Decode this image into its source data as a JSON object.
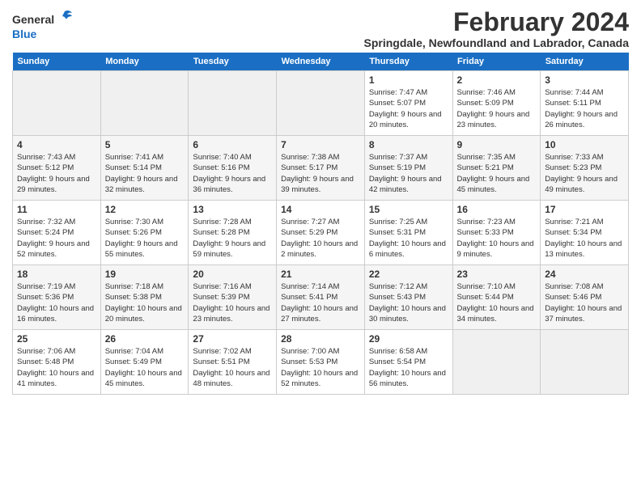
{
  "logo": {
    "general": "General",
    "blue": "Blue"
  },
  "title": "February 2024",
  "subtitle": "Springdale, Newfoundland and Labrador, Canada",
  "headers": [
    "Sunday",
    "Monday",
    "Tuesday",
    "Wednesday",
    "Thursday",
    "Friday",
    "Saturday"
  ],
  "weeks": [
    [
      {
        "day": "",
        "info": ""
      },
      {
        "day": "",
        "info": ""
      },
      {
        "day": "",
        "info": ""
      },
      {
        "day": "",
        "info": ""
      },
      {
        "day": "1",
        "info": "Sunrise: 7:47 AM\nSunset: 5:07 PM\nDaylight: 9 hours and 20 minutes."
      },
      {
        "day": "2",
        "info": "Sunrise: 7:46 AM\nSunset: 5:09 PM\nDaylight: 9 hours and 23 minutes."
      },
      {
        "day": "3",
        "info": "Sunrise: 7:44 AM\nSunset: 5:11 PM\nDaylight: 9 hours and 26 minutes."
      }
    ],
    [
      {
        "day": "4",
        "info": "Sunrise: 7:43 AM\nSunset: 5:12 PM\nDaylight: 9 hours and 29 minutes."
      },
      {
        "day": "5",
        "info": "Sunrise: 7:41 AM\nSunset: 5:14 PM\nDaylight: 9 hours and 32 minutes."
      },
      {
        "day": "6",
        "info": "Sunrise: 7:40 AM\nSunset: 5:16 PM\nDaylight: 9 hours and 36 minutes."
      },
      {
        "day": "7",
        "info": "Sunrise: 7:38 AM\nSunset: 5:17 PM\nDaylight: 9 hours and 39 minutes."
      },
      {
        "day": "8",
        "info": "Sunrise: 7:37 AM\nSunset: 5:19 PM\nDaylight: 9 hours and 42 minutes."
      },
      {
        "day": "9",
        "info": "Sunrise: 7:35 AM\nSunset: 5:21 PM\nDaylight: 9 hours and 45 minutes."
      },
      {
        "day": "10",
        "info": "Sunrise: 7:33 AM\nSunset: 5:23 PM\nDaylight: 9 hours and 49 minutes."
      }
    ],
    [
      {
        "day": "11",
        "info": "Sunrise: 7:32 AM\nSunset: 5:24 PM\nDaylight: 9 hours and 52 minutes."
      },
      {
        "day": "12",
        "info": "Sunrise: 7:30 AM\nSunset: 5:26 PM\nDaylight: 9 hours and 55 minutes."
      },
      {
        "day": "13",
        "info": "Sunrise: 7:28 AM\nSunset: 5:28 PM\nDaylight: 9 hours and 59 minutes."
      },
      {
        "day": "14",
        "info": "Sunrise: 7:27 AM\nSunset: 5:29 PM\nDaylight: 10 hours and 2 minutes."
      },
      {
        "day": "15",
        "info": "Sunrise: 7:25 AM\nSunset: 5:31 PM\nDaylight: 10 hours and 6 minutes."
      },
      {
        "day": "16",
        "info": "Sunrise: 7:23 AM\nSunset: 5:33 PM\nDaylight: 10 hours and 9 minutes."
      },
      {
        "day": "17",
        "info": "Sunrise: 7:21 AM\nSunset: 5:34 PM\nDaylight: 10 hours and 13 minutes."
      }
    ],
    [
      {
        "day": "18",
        "info": "Sunrise: 7:19 AM\nSunset: 5:36 PM\nDaylight: 10 hours and 16 minutes."
      },
      {
        "day": "19",
        "info": "Sunrise: 7:18 AM\nSunset: 5:38 PM\nDaylight: 10 hours and 20 minutes."
      },
      {
        "day": "20",
        "info": "Sunrise: 7:16 AM\nSunset: 5:39 PM\nDaylight: 10 hours and 23 minutes."
      },
      {
        "day": "21",
        "info": "Sunrise: 7:14 AM\nSunset: 5:41 PM\nDaylight: 10 hours and 27 minutes."
      },
      {
        "day": "22",
        "info": "Sunrise: 7:12 AM\nSunset: 5:43 PM\nDaylight: 10 hours and 30 minutes."
      },
      {
        "day": "23",
        "info": "Sunrise: 7:10 AM\nSunset: 5:44 PM\nDaylight: 10 hours and 34 minutes."
      },
      {
        "day": "24",
        "info": "Sunrise: 7:08 AM\nSunset: 5:46 PM\nDaylight: 10 hours and 37 minutes."
      }
    ],
    [
      {
        "day": "25",
        "info": "Sunrise: 7:06 AM\nSunset: 5:48 PM\nDaylight: 10 hours and 41 minutes."
      },
      {
        "day": "26",
        "info": "Sunrise: 7:04 AM\nSunset: 5:49 PM\nDaylight: 10 hours and 45 minutes."
      },
      {
        "day": "27",
        "info": "Sunrise: 7:02 AM\nSunset: 5:51 PM\nDaylight: 10 hours and 48 minutes."
      },
      {
        "day": "28",
        "info": "Sunrise: 7:00 AM\nSunset: 5:53 PM\nDaylight: 10 hours and 52 minutes."
      },
      {
        "day": "29",
        "info": "Sunrise: 6:58 AM\nSunset: 5:54 PM\nDaylight: 10 hours and 56 minutes."
      },
      {
        "day": "",
        "info": ""
      },
      {
        "day": "",
        "info": ""
      }
    ]
  ]
}
